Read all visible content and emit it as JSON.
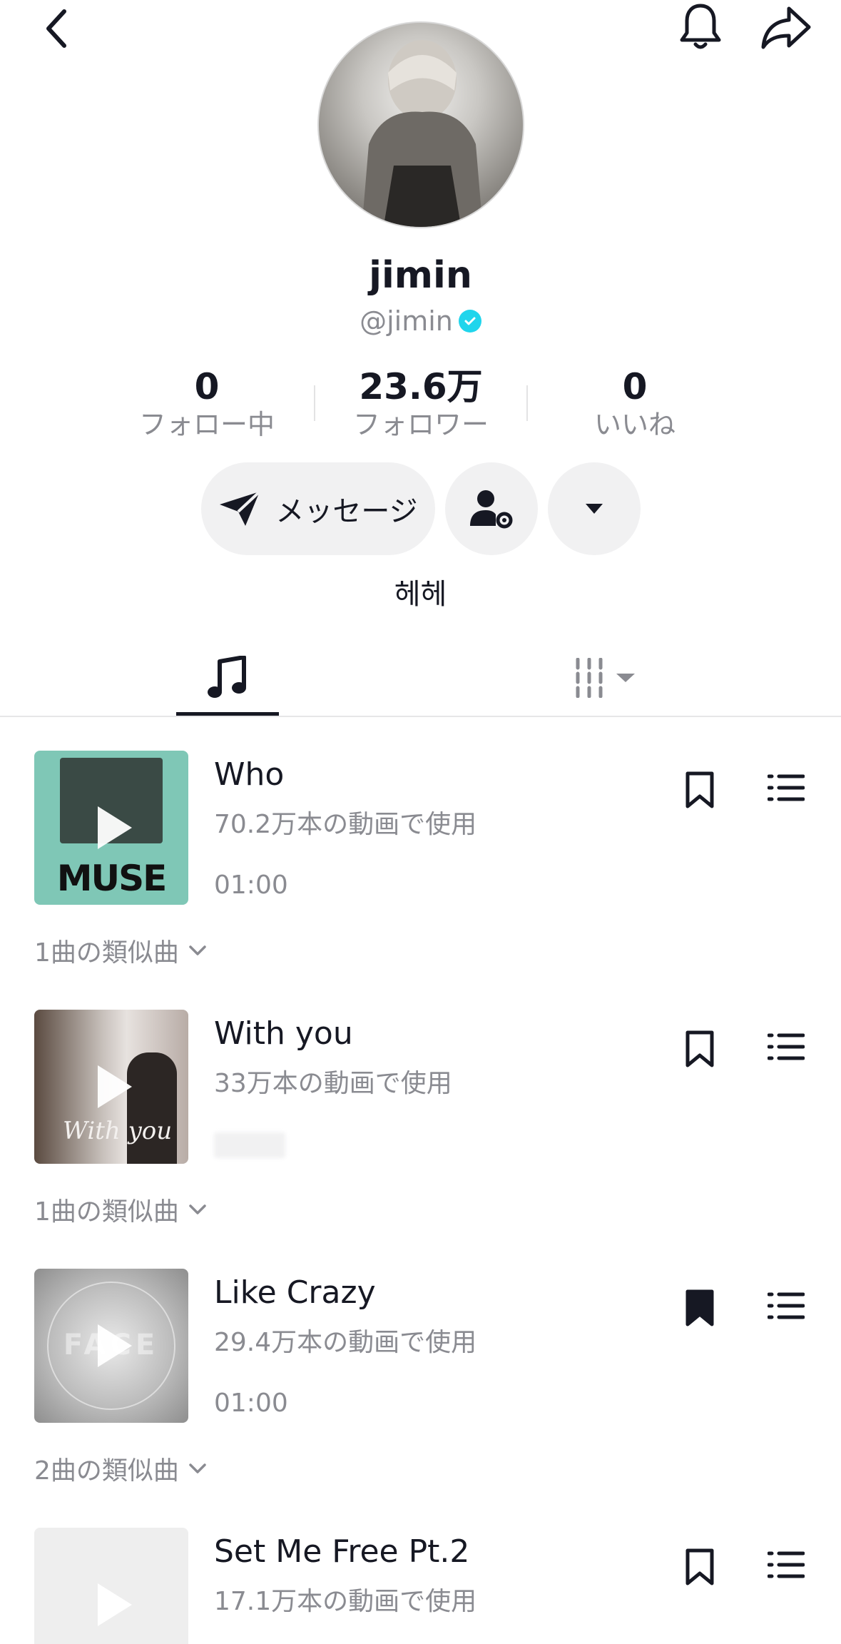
{
  "profile": {
    "display_name": "jimin",
    "handle": "@jimin",
    "bio": "헤헤"
  },
  "stats": [
    {
      "value": "0",
      "label": "フォロー中"
    },
    {
      "value": "23.6万",
      "label": "フォロワー"
    },
    {
      "value": "0",
      "label": "いいね"
    }
  ],
  "actions": {
    "message_label": "メッセージ"
  },
  "tracks": [
    {
      "title": "Who",
      "uses": "70.2万本の動画で使用",
      "duration": "01:00",
      "similar": "1曲の類似曲",
      "bookmarked": false,
      "cover_text": "MUSE"
    },
    {
      "title": "With you",
      "uses": "33万本の動画で使用",
      "duration": "",
      "similar": "1曲の類似曲",
      "bookmarked": false,
      "cover_text": "With you"
    },
    {
      "title": "Like Crazy",
      "uses": "29.4万本の動画で使用",
      "duration": "01:00",
      "similar": "2曲の類似曲",
      "bookmarked": true,
      "cover_text": "FACE"
    },
    {
      "title": "Set Me Free Pt.2",
      "uses": "17.1万本の動画で使用",
      "duration": "",
      "similar": "",
      "bookmarked": false,
      "cover_text": ""
    }
  ],
  "colors": {
    "verified": "#20d5ec",
    "text_primary": "#161823",
    "text_secondary": "#8a8b91",
    "button_bg": "#f1f1f2"
  },
  "icons": [
    "back-icon",
    "bell-icon",
    "share-icon",
    "verified-icon",
    "send-icon",
    "user-settings-icon",
    "dropdown-icon",
    "music-note-icon",
    "columns-icon",
    "play-icon",
    "bookmark-icon",
    "playlist-icon",
    "chevron-down-icon"
  ]
}
